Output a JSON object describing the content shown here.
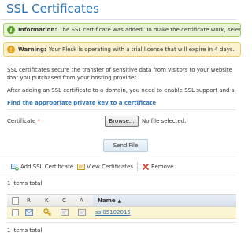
{
  "page": {
    "title": "SSL Certificates"
  },
  "messages": {
    "info": {
      "label": "Information:",
      "text": "The SSL certificate was added. To make the certificate work, select"
    },
    "warning": {
      "label": "Warning:",
      "text": "Your Plesk is operating with a trial license that will expire in 4 days."
    }
  },
  "intro": {
    "line1": "SSL certificates secure the transfer of sensitive data from visitors to your website",
    "line2": "that you purchased from your hosting provider.",
    "line3": "After adding an SSL certificate to a domain, you need to enable SSL support and s"
  },
  "find_key_link": "Find the appropriate private key to a certificate",
  "upload": {
    "certificate_label": "Certificate",
    "required_mark": "*",
    "browse_label": "Browse...",
    "no_file_text": "No file selected.",
    "send_label": "Send File"
  },
  "toolbar": {
    "add_label": "Add SSL Certificate",
    "view_label": "View Certificates",
    "remove_label": "Remove"
  },
  "items_total_top": "1 items total",
  "items_total_bottom": "1 items total",
  "table": {
    "headers": {
      "r": "R",
      "k": "K",
      "c": "C",
      "a": "A",
      "name": "Name",
      "sort_indicator": "▲"
    },
    "rows": [
      {
        "name": "ssl05102015"
      }
    ]
  },
  "colors": {
    "accent": "#2f74b4",
    "info_bg": "#e6f3d4",
    "warning_bg": "#fbf1cf",
    "row_highlight": "#fbf5d3"
  },
  "icons": {
    "info": "info-icon",
    "warning": "warning-icon",
    "add": "add-certificate-icon",
    "view": "view-certificates-icon",
    "remove": "remove-icon",
    "request": "request-icon",
    "key": "key-icon",
    "certificate": "certificate-icon",
    "ca": "ca-certificate-icon"
  }
}
